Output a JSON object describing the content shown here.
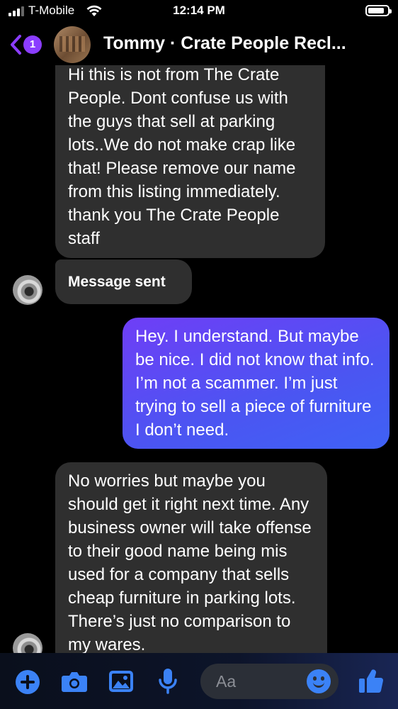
{
  "status": {
    "carrier": "T-Mobile",
    "time": "12:14 PM",
    "battery_level": 0.85
  },
  "header": {
    "back_badge": "1",
    "title": "Tommy · Crate People Recl..."
  },
  "messages": [
    {
      "from": "them",
      "text": "Hi this is not from The Crate People. Dont confuse us with the guys that sell at parking lots..We do not make crap like that! Please remove our name from this listing immediately. thank you The Crate People staff"
    },
    {
      "from": "them",
      "text": "Message sent"
    },
    {
      "from": "me",
      "text": "Hey. I understand. But maybe be nice. I did not know that info. I’m not a scammer. I’m just trying to sell a piece of furniture I don’t need."
    },
    {
      "from": "them",
      "text": "No worries but maybe you should get it right next time. Any business owner will take offense to their good name being mis used for a company that sells cheap furniture in parking lots. There’s just no comparison to my wares."
    }
  ],
  "composer": {
    "placeholder": "Aa",
    "icons": [
      "plus-icon",
      "camera-icon",
      "gallery-icon",
      "microphone-icon",
      "emoji-icon",
      "thumbs-up-icon"
    ]
  },
  "colors": {
    "accent": "#3b82f6",
    "badge": "#8b3dff",
    "incoming_bubble": "#2f2f2f",
    "outgoing_bubble_start": "#6f3ef6",
    "outgoing_bubble_end": "#3f62f5"
  }
}
